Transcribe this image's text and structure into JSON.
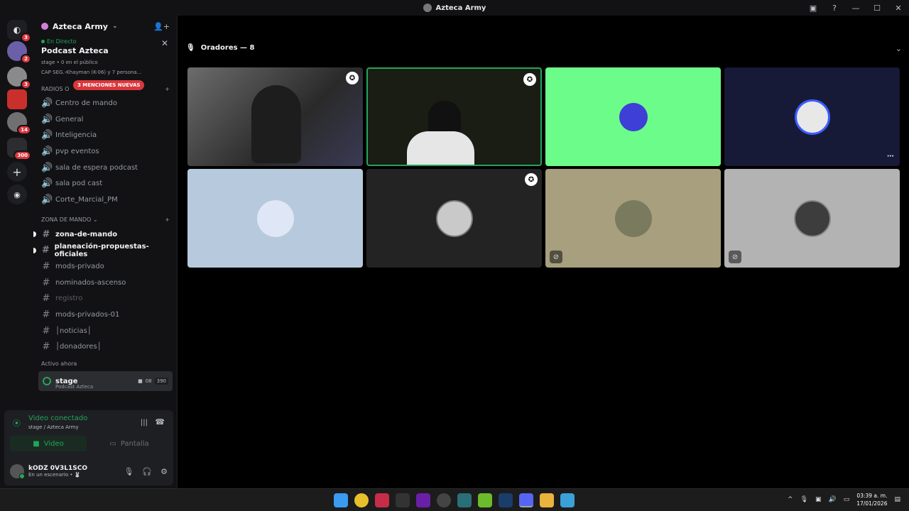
{
  "window": {
    "title": "Azteca Army"
  },
  "server": {
    "name": "Azteca Army"
  },
  "live": {
    "label": "En Directo",
    "title": "Podcast Azteca",
    "info": "stage • 0 en el público",
    "participants": "CAP SEG.-Khayman (K-06) y 7 persona..."
  },
  "mentions": {
    "label": "3 MENCIONES NUEVAS"
  },
  "categories": {
    "radios": "RADIOS O",
    "zona": "ZONA DE MANDO"
  },
  "channels_top": [
    {
      "label": "Centro de mando"
    },
    {
      "label": "General"
    },
    {
      "label": "Inteligencia"
    },
    {
      "label": "pvp eventos"
    },
    {
      "label": "sala de espera podcast"
    },
    {
      "label": "sala pod cast"
    },
    {
      "label": "Corte_Marcial_PM"
    }
  ],
  "channels_zona": [
    {
      "label": "zona-de-mando"
    },
    {
      "label": "planeación-propuestas-oficiales"
    },
    {
      "label": "mods-privado"
    },
    {
      "label": "nominados-ascenso"
    },
    {
      "label": "registro"
    },
    {
      "label": "mods-privados-01"
    },
    {
      "label": "│noticias│"
    },
    {
      "label": "│donadores│"
    }
  ],
  "active_now": {
    "label": "Activo ahora",
    "stage": {
      "name": "stage",
      "sub": "Podcast Azteca",
      "video_count": "08",
      "count": "390"
    }
  },
  "voice": {
    "status": "Video conectado",
    "location": "stage / Azteca Army",
    "video_label": "Video",
    "screen_label": "Pantalla"
  },
  "user": {
    "name": "kODZ 0V3L1SCO",
    "status": "En un escenario • 🐰"
  },
  "main": {
    "speakers_label": "Oradores — 8"
  },
  "guild_badges": [
    "3",
    "2",
    "3",
    "14",
    "300"
  ],
  "taskbar": {
    "time": "03:39 a. m.",
    "date": "17/01/2026"
  },
  "colors": {
    "accent_green": "#23a55a",
    "mention_red": "#da373c",
    "tile_green": "#6bfc8a",
    "tile_navy": "#161a36",
    "tile_lightblue": "#b7c9dc"
  }
}
